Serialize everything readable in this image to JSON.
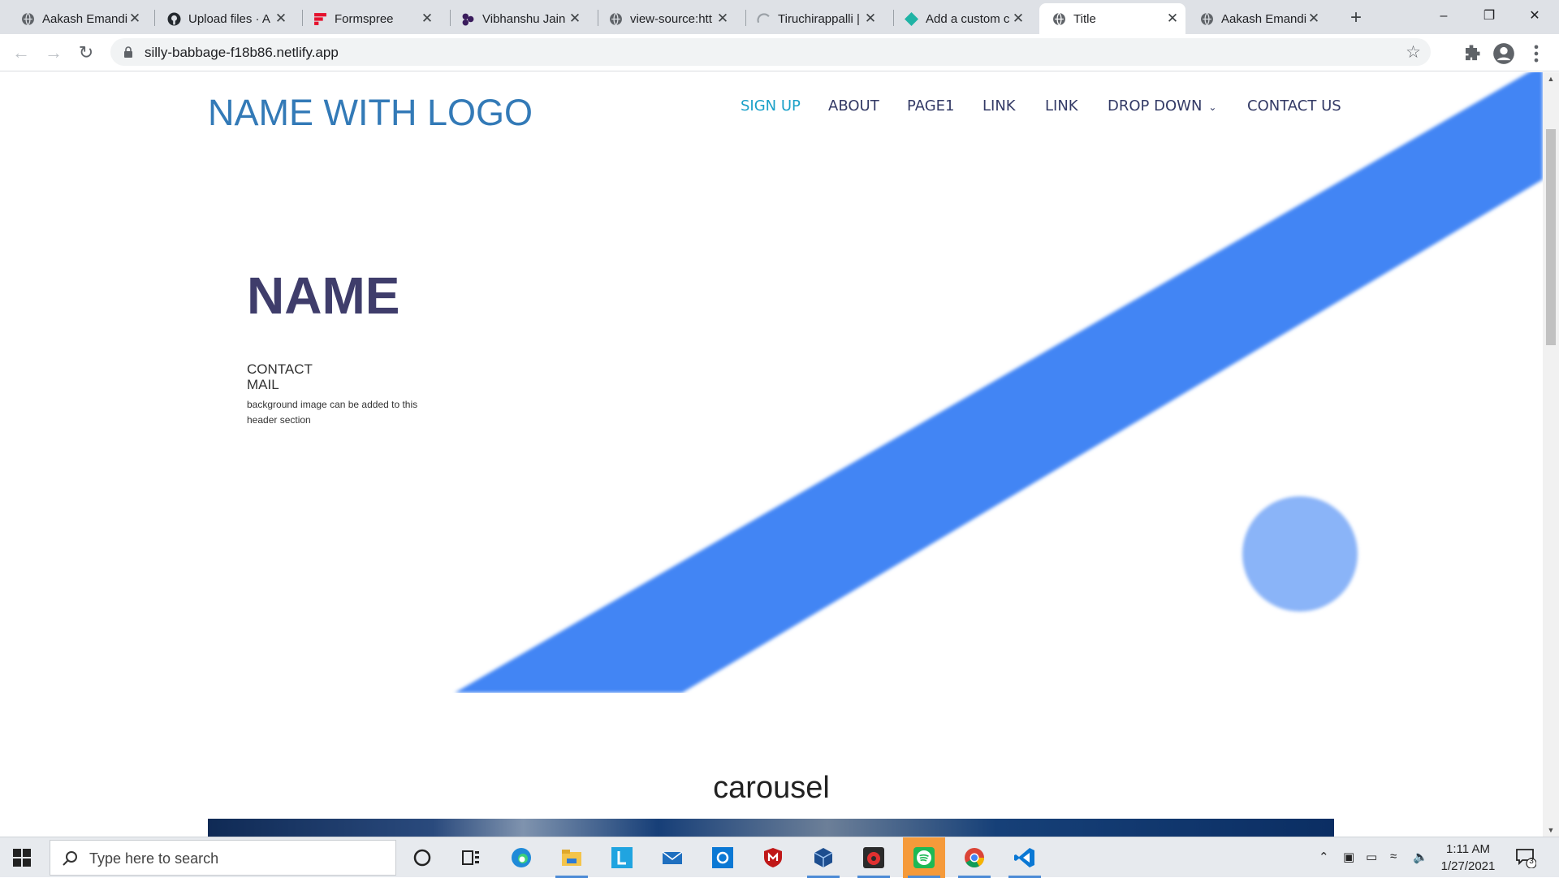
{
  "browser": {
    "tabs": [
      {
        "title": "Aakash Emandi",
        "icon": "globe-icon"
      },
      {
        "title": "Upload files · A",
        "icon": "github-icon"
      },
      {
        "title": "Formspree",
        "icon": "formspree-icon"
      },
      {
        "title": "Vibhanshu Jain",
        "icon": "profile-icon"
      },
      {
        "title": "view-source:htt",
        "icon": "globe-icon"
      },
      {
        "title": "Tiruchirappalli |",
        "icon": "loading-icon"
      },
      {
        "title": "Add a custom c",
        "icon": "netlify-icon"
      },
      {
        "title": "Title",
        "icon": "globe-icon",
        "active": true
      },
      {
        "title": "Aakash Emandi",
        "icon": "globe-icon"
      }
    ],
    "url": "silly-babbage-f18b86.netlify.app"
  },
  "page": {
    "brand": "NAME WITH LOGO",
    "nav": [
      {
        "label": "SIGN UP"
      },
      {
        "label": "ABOUT"
      },
      {
        "label": "PAGE1"
      },
      {
        "label": "LINK"
      },
      {
        "label": "LINK"
      },
      {
        "label": "DROP DOWN"
      },
      {
        "label": "CONTACT US"
      }
    ],
    "hero": {
      "title": "NAME",
      "line1": "CONTACT",
      "line2": "MAIL",
      "note": "background image can be added to this header section"
    },
    "carousel_title": "carousel"
  },
  "taskbar": {
    "search_placeholder": "Type here to search",
    "time": "1:11 AM",
    "date": "1/27/2021",
    "notification_count": "3"
  },
  "colors": {
    "accent_blue": "#4285f4",
    "circle_blue": "#8ab4f8",
    "brand_blue": "#337ab7",
    "nav_text": "#333a66",
    "nav_active": "#19a0c8"
  }
}
